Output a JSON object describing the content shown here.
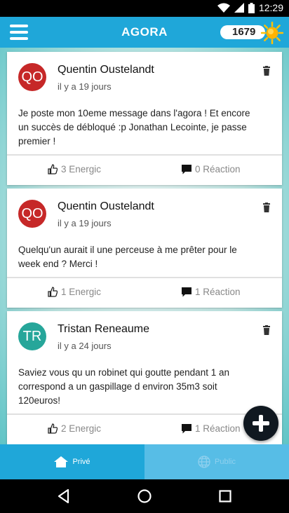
{
  "status_bar": {
    "time": "12:29"
  },
  "app_bar": {
    "title": "AGORA",
    "score": "1679"
  },
  "posts": [
    {
      "initials": "QO",
      "avatar_color": "#c62828",
      "author": "Quentin Oustelandt",
      "time": "il y a 19 jours",
      "lines": [
        "Je poste mon 10eme message dans l'agora ! Et encore",
        "un succès de débloqué :p Jonathan Lecointe, je passe",
        "premier !"
      ],
      "energic": "3 Energic",
      "reaction": "0 Réaction"
    },
    {
      "initials": "QO",
      "avatar_color": "#c62828",
      "author": "Quentin Oustelandt",
      "time": "il y a 19 jours",
      "lines": [
        "Quelqu'un aurait il une perceuse à me prêter pour le",
        "week end ? Merci !"
      ],
      "energic": "1 Energic",
      "reaction": "1 Réaction"
    },
    {
      "initials": "TR",
      "avatar_color": "#26a69a",
      "author": "Tristan Reneaume",
      "time": "il y a 24 jours",
      "lines": [
        "Saviez vous qu un robinet qui goutte pendant 1 an",
        "correspond a un gaspillage d environ 35m3 soit",
        "120euros!"
      ],
      "energic": "2 Energic",
      "reaction": "1 Réaction"
    }
  ],
  "tabs": {
    "private": "Privé",
    "public": "Public"
  },
  "colors": {
    "accent": "#1fa7d9",
    "tab_inactive": "#57bde6"
  }
}
